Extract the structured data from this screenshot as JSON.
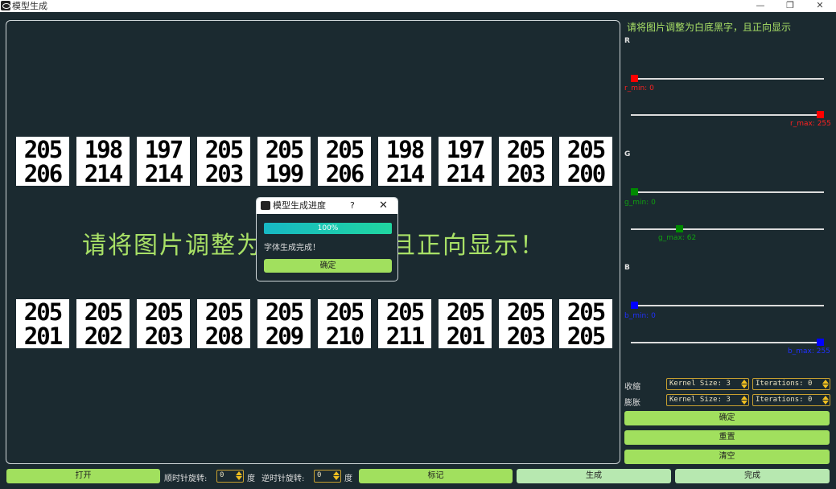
{
  "window": {
    "title": "模型生成",
    "minimize": "—",
    "restore": "❐",
    "close": "✕"
  },
  "canvas": {
    "row1": [
      {
        "top": "205",
        "bottom": "206"
      },
      {
        "top": "198",
        "bottom": "214"
      },
      {
        "top": "197",
        "bottom": "214"
      },
      {
        "top": "205",
        "bottom": "203"
      },
      {
        "top": "205",
        "bottom": "199"
      },
      {
        "top": "205",
        "bottom": "206"
      },
      {
        "top": "198",
        "bottom": "214"
      },
      {
        "top": "197",
        "bottom": "214"
      },
      {
        "top": "205",
        "bottom": "203"
      },
      {
        "top": "205",
        "bottom": "200"
      }
    ],
    "row2": [
      {
        "top": "205",
        "bottom": "201"
      },
      {
        "top": "205",
        "bottom": "202"
      },
      {
        "top": "205",
        "bottom": "203"
      },
      {
        "top": "205",
        "bottom": "208"
      },
      {
        "top": "205",
        "bottom": "209"
      },
      {
        "top": "205",
        "bottom": "210"
      },
      {
        "top": "205",
        "bottom": "211"
      },
      {
        "top": "205",
        "bottom": "201"
      },
      {
        "top": "205",
        "bottom": "203"
      },
      {
        "top": "205",
        "bottom": "205"
      }
    ],
    "overlay_text": "请将图片调整为白底黑字，且正向显示！"
  },
  "dialog": {
    "title": "模型生成进度",
    "help": "?",
    "close": "✕",
    "progress_text": "100%",
    "progress_value": 1.0,
    "message": "字体生成完成！",
    "ok_label": "确定"
  },
  "panel": {
    "hint": "请将图片调整为白底黑字，且正向显示",
    "r_label": "R",
    "g_label": "G",
    "b_label": "B",
    "r_min_label": "r_min: 0",
    "r_max_label": "r_max: 255",
    "g_min_label": "g_min: 0",
    "g_max_label": "g_max: 62",
    "b_min_label": "b_min: 0",
    "b_max_label": "b_max: 255",
    "r_min": 0,
    "r_max": 255,
    "g_min": 0,
    "g_max": 62,
    "b_min": 0,
    "b_max": 255,
    "erode_label": "收缩",
    "dilate_label": "膨胀",
    "erode_kernel": "Kernel Size: 3",
    "erode_iter": "Iterations: 0",
    "dilate_kernel": "Kernel Size: 3",
    "dilate_iter": "Iterations: 0",
    "confirm_label": "确定",
    "reset_label": "重置",
    "clear_label": "清空"
  },
  "bottom": {
    "open_label": "打开",
    "cw_label": "顺时针旋转:",
    "cw_value": "0",
    "deg1": "度",
    "ccw_label": "逆时针旋转:",
    "ccw_value": "0",
    "deg2": "度",
    "mark_label": "标记",
    "generate_label": "生成",
    "finish_label": "完成"
  },
  "colors": {
    "accent_green": "#a1e05e",
    "light_green": "#b7e8b0",
    "hint_green": "#a8e066",
    "r": "#ff0000",
    "g": "#008a00",
    "b": "#0000ff"
  }
}
